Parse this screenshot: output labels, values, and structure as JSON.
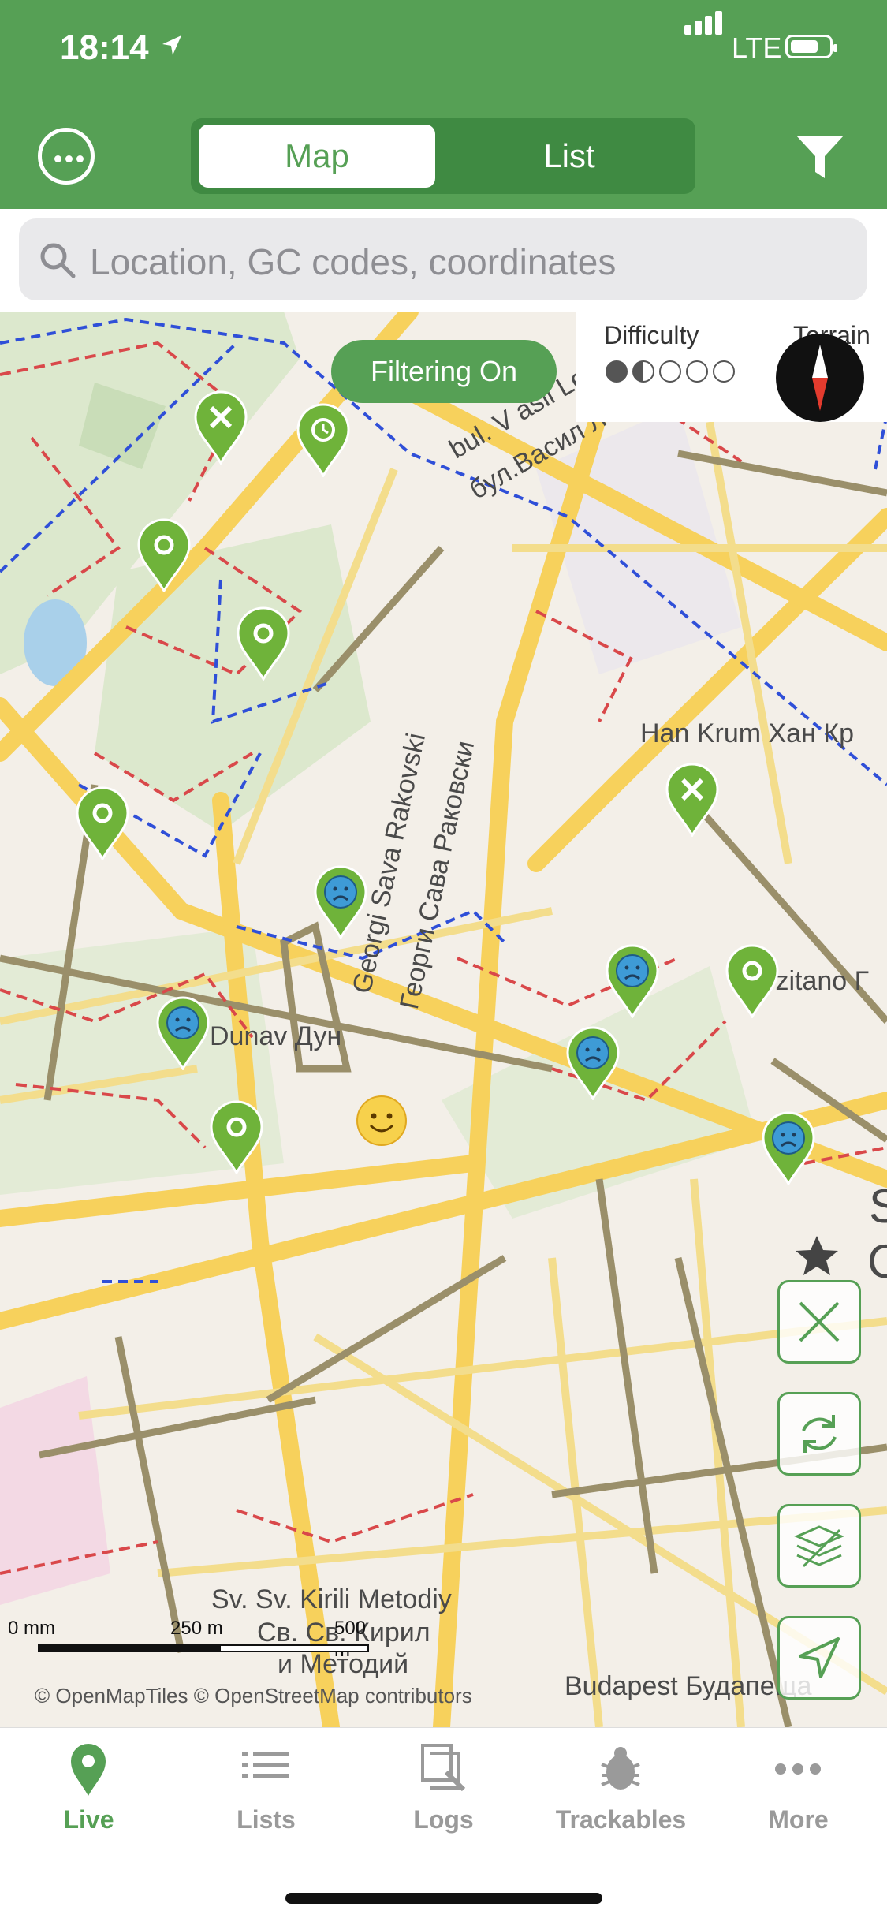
{
  "status": {
    "time": "18:14",
    "network": "LTE"
  },
  "header": {
    "map_tab": "Map",
    "list_tab": "List"
  },
  "search": {
    "placeholder": "Location, GC codes, coordinates"
  },
  "map": {
    "filter_pill": "Filtering On",
    "difficulty_label": "Difficulty",
    "terrain_label": "Terrain",
    "difficulty_rating": 1.5,
    "labels": {
      "street1": "bul. V asil Le",
      "street1_cyr": "бул.Васил Левски",
      "han_krum": "Han Krum Хан Кр",
      "hozitano": "Hozitano Г",
      "dunav": "Dunav Дун",
      "rakovski": "Georgi Sava Rakovski",
      "rakovski_cyr": "Георги Сава Раковски",
      "kiril": "Sv. Sv. Kirili Metodiy",
      "kiril_cyr": "Св. Св. Кирил",
      "metodiy_cyr": "и Методий",
      "budapest": "Budapest Будапеща",
      "edge": "S",
      "edge2": "C"
    },
    "scale": {
      "a": "0 mm",
      "b": "250 m",
      "c": "500 m"
    },
    "attribution": "© OpenMapTiles © OpenStreetMap contributors"
  },
  "tabs": [
    {
      "label": "Live",
      "icon": "map-pin-icon"
    },
    {
      "label": "Lists",
      "icon": "list-icon"
    },
    {
      "label": "Logs",
      "icon": "logs-icon"
    },
    {
      "label": "Trackables",
      "icon": "trackable-bug-icon"
    },
    {
      "label": "More",
      "icon": "more-dots-icon"
    }
  ],
  "colors": {
    "brand": "#56A055",
    "brand_dark": "#3F8A42",
    "pin_blue": "#3E9BD6",
    "road_major": "#F7D15C",
    "road_minor": "#9A8F6A",
    "boundary": "#2F4FD8"
  }
}
